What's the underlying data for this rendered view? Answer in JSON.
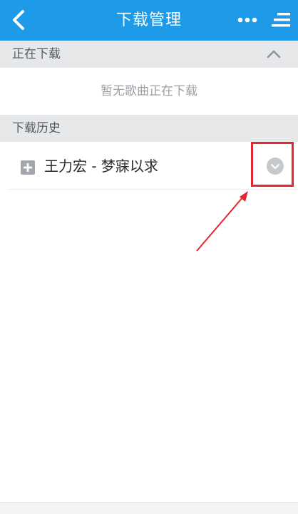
{
  "colors": {
    "header_bg": "#1e9be8",
    "annotation": "#e3262f"
  },
  "header": {
    "title": "下载管理",
    "icons": {
      "back": "back-arrow-icon",
      "more": "more-dots-icon",
      "menu": "menu-lines-icon"
    }
  },
  "downloading": {
    "label": "正在下载",
    "collapse_icon": "chevron-up-icon",
    "empty_text": "暂无歌曲正在下载"
  },
  "history": {
    "label": "下载历史",
    "items": [
      {
        "title": "王力宏 - 梦寐以求",
        "icon": "plus-square-icon",
        "action_icon": "chevron-down-circle-icon"
      }
    ]
  }
}
